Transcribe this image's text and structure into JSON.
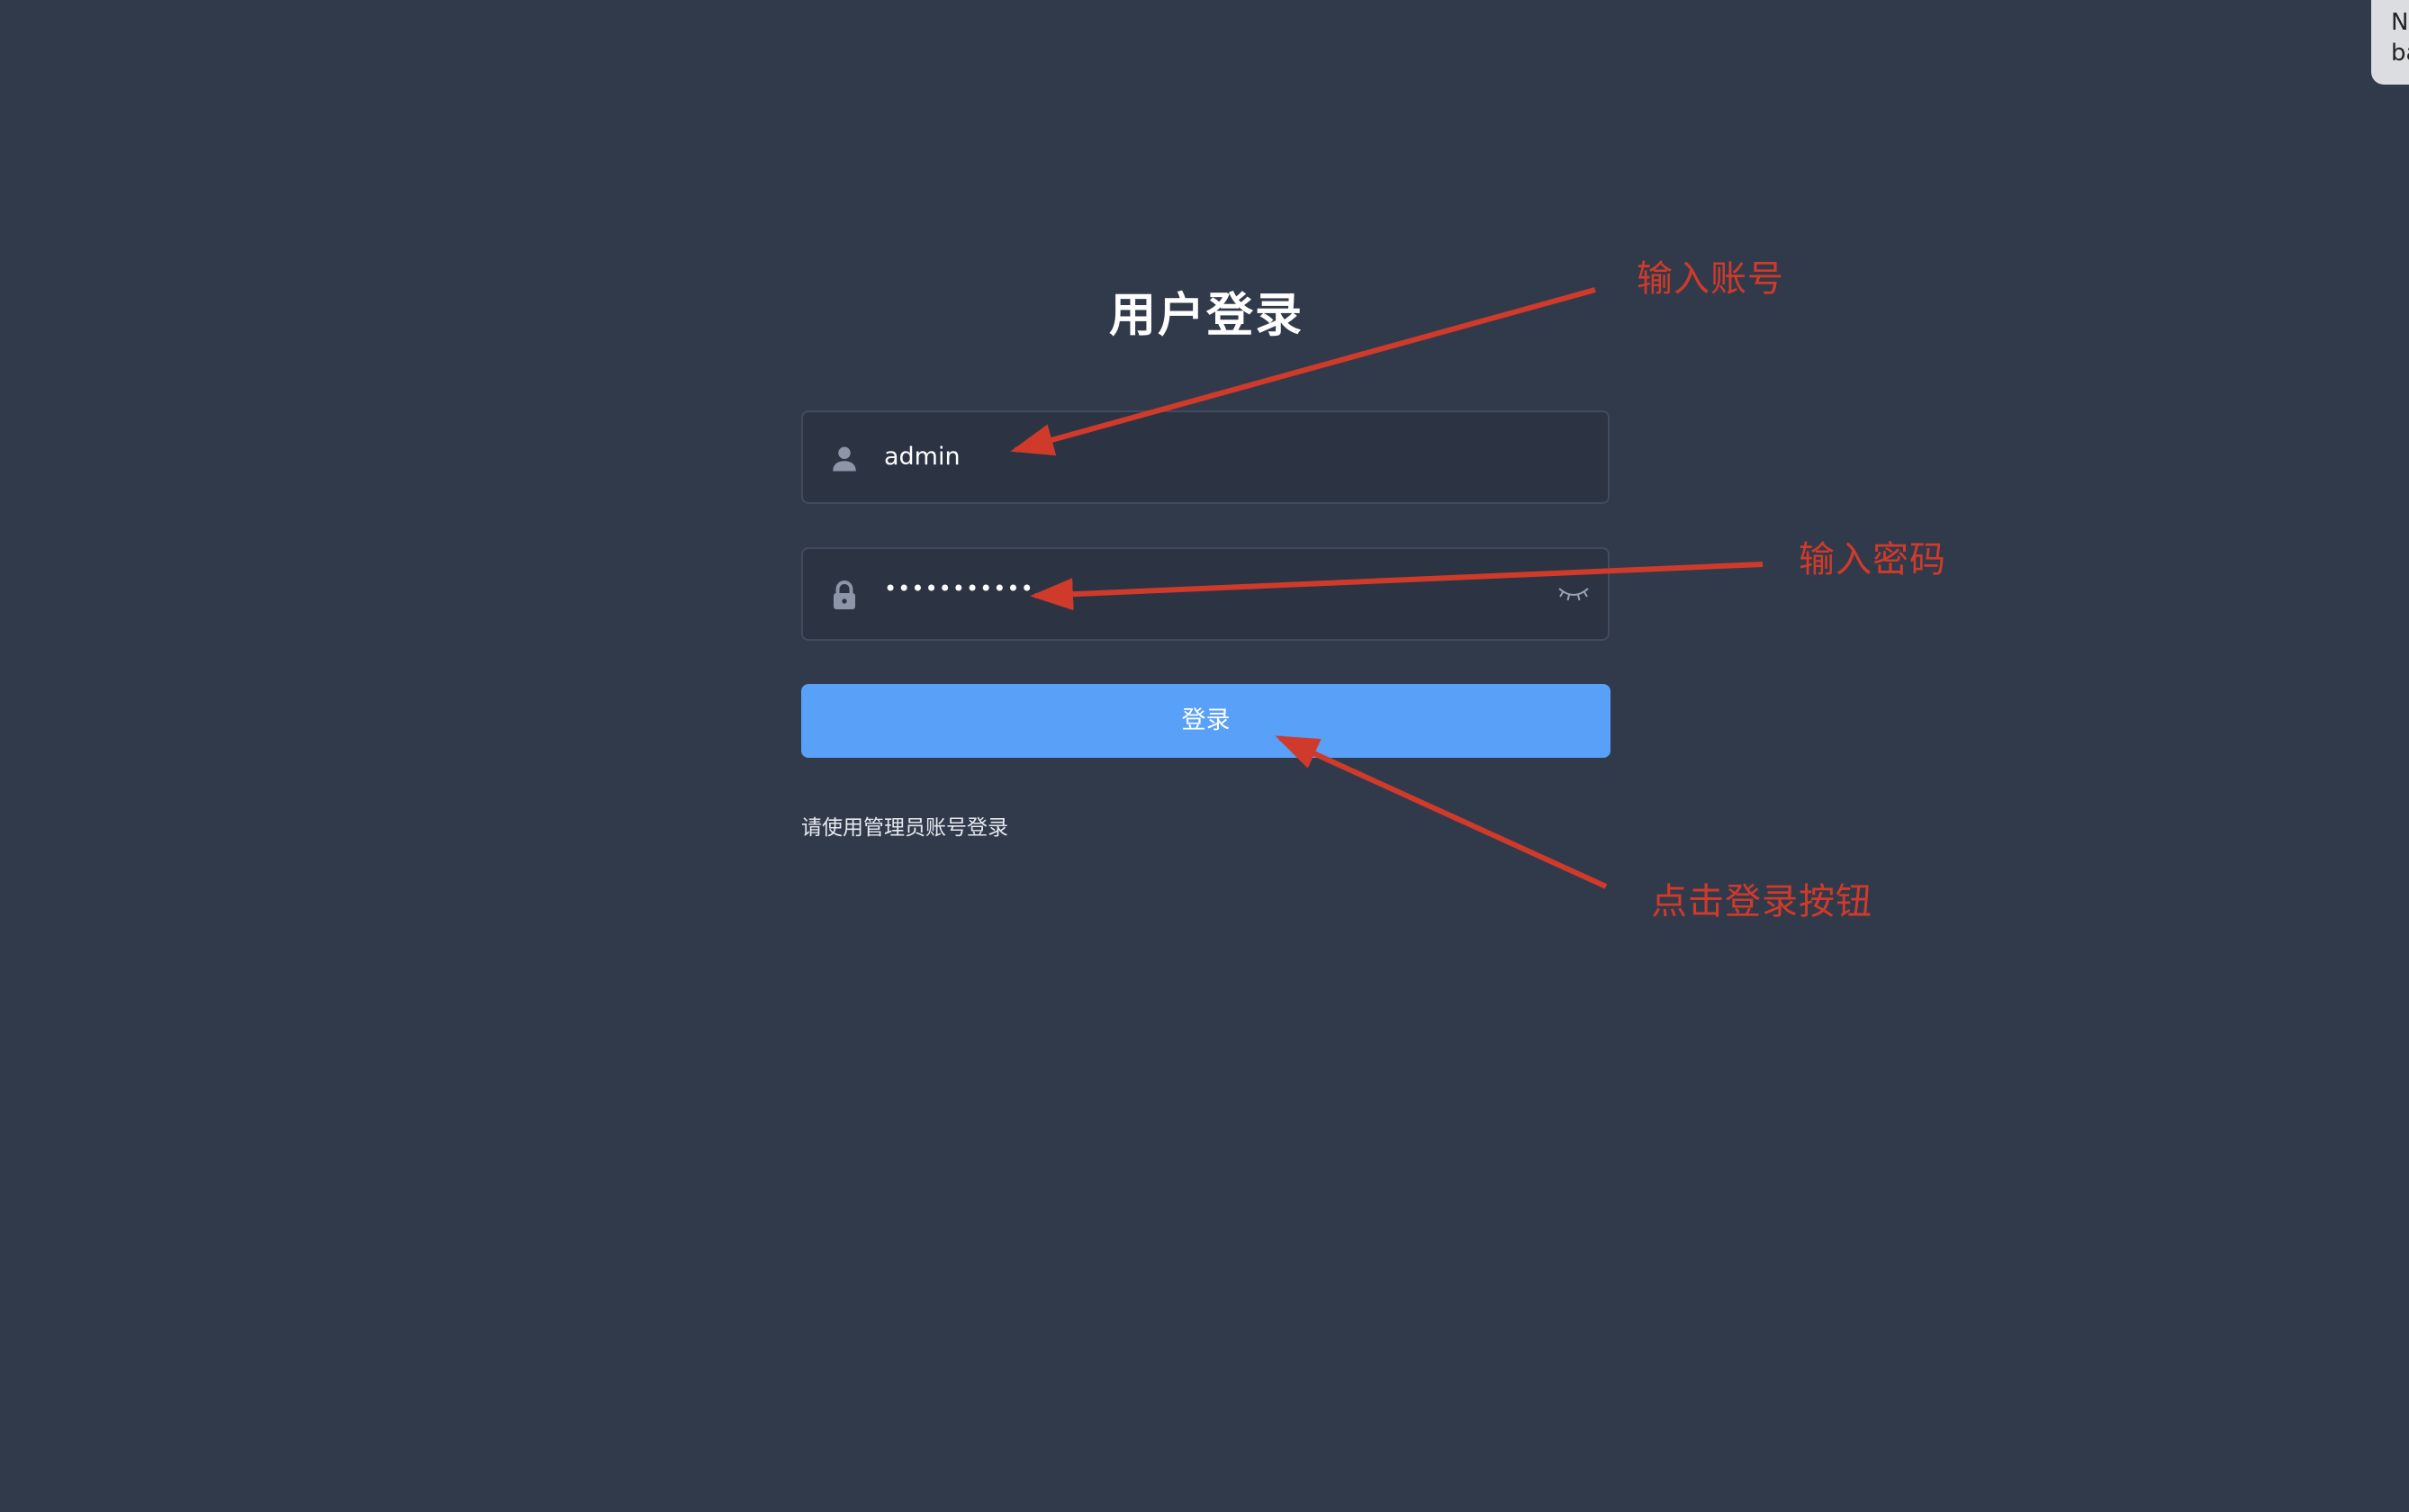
{
  "login": {
    "title": "用户登录",
    "username_value": "admin",
    "password_value": "•••••••••••",
    "submit_label": "登录",
    "hint": "请使用管理员账号登录"
  },
  "annotations": {
    "enter_account": "输入账号",
    "enter_password": "输入密码",
    "click_login": "点击登录按钮"
  },
  "corner_tip": {
    "line1": "N",
    "line2": "ba"
  },
  "icons": {
    "username": "user-icon",
    "password": "lock-icon",
    "toggle_password": "eye-closed-icon"
  },
  "colors": {
    "background": "#313a4b",
    "input_background": "#2c3444",
    "primary_button": "#58a0f8",
    "annotation": "#d03a2a"
  }
}
